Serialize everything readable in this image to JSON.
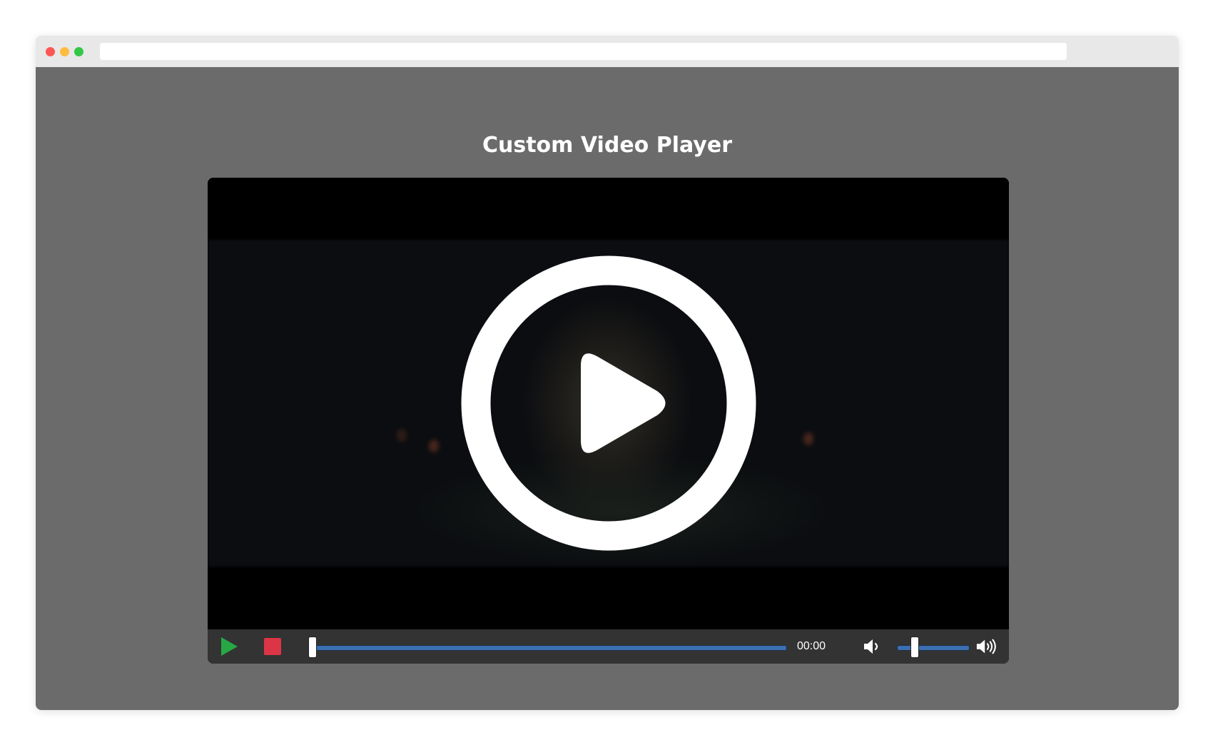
{
  "page": {
    "title": "Custom Video Player",
    "background_color": "#6b6b6b"
  },
  "browser": {
    "window_buttons": [
      "close",
      "minimize",
      "maximize"
    ],
    "address": ""
  },
  "player": {
    "state": "paused",
    "overlay_icon": "large-play-circle-icon",
    "controls": {
      "play_icon": "play-icon",
      "play_color": "#28a745",
      "stop_icon": "stop-icon",
      "stop_color": "#dc3545",
      "progress_fraction": 0.0,
      "time": "00:00",
      "mute_icon": "volume-down-icon",
      "volume_fraction": 0.2,
      "volume_up_icon": "volume-up-icon",
      "slider_color": "#3a6fb0"
    }
  }
}
